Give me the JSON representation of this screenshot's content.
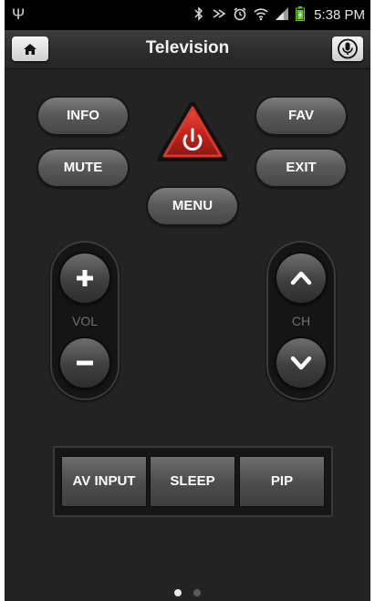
{
  "status_bar": {
    "time": "5:38 PM",
    "usb_icon": "usb-icon",
    "icons": [
      "bluetooth-icon",
      "nfc-icon",
      "alarm-icon",
      "wifi-icon",
      "signal-icon",
      "battery-icon"
    ]
  },
  "header": {
    "title": "Television",
    "home_icon": "home-icon",
    "mic_icon": "microphone-icon"
  },
  "buttons": {
    "info": "INFO",
    "fav": "FAV",
    "mute": "MUTE",
    "exit": "EXIT",
    "menu": "MENU",
    "power_icon": "power-icon"
  },
  "volume": {
    "label": "VOL",
    "up_icon": "plus-icon",
    "down_icon": "minus-icon"
  },
  "channel": {
    "label": "CH",
    "up_icon": "chevron-up-icon",
    "down_icon": "chevron-down-icon"
  },
  "bottom_buttons": [
    "AV INPUT",
    "SLEEP",
    "PIP"
  ],
  "page_indicator": {
    "count": 2,
    "active": 1
  },
  "colors": {
    "power_red": "#c0231c",
    "background": "#232323",
    "battery_green": "#63c62e"
  }
}
